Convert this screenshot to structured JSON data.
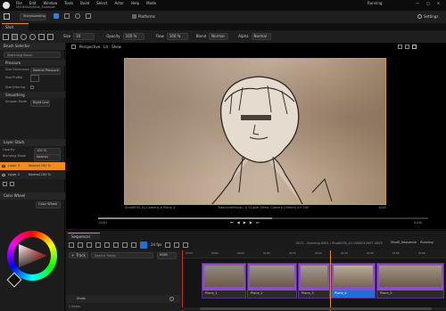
{
  "window": {
    "menu": [
      "File",
      "Edit",
      "Window",
      "Tools",
      "Build",
      "Select",
      "Actor",
      "Help",
      "Mode"
    ],
    "project": "MyUEStorytelle_Example",
    "mode_label": "Running",
    "level_tab": "Shot",
    "mode_dropdown": "Storyboarding",
    "platforms": "Platforms",
    "settings": "Settings"
  },
  "toolbar": {
    "size_label": "Size",
    "size_value": "10",
    "opacity_label": "Opacity",
    "opacity_value": "100 %",
    "flow_label": "Flow",
    "flow_value": "100 %",
    "blend_label": "Blend",
    "blend_value": "Normal",
    "alpha_label": "Alpha",
    "alpha_value": "Normal"
  },
  "brush_panel": {
    "title": "Brush Selector",
    "brush_name": "Sketching Brush",
    "section_pressure": "Pressure",
    "size_dimension_label": "Size Dimension",
    "size_dimension_value": "Normal Pressure",
    "size_profile_label": "Size Profile",
    "jitter_label": "Size Jittering",
    "section_smoothing": "Smoothing",
    "smooth_mode_label": "Smooth Mode",
    "smooth_mode_value": "Right Line"
  },
  "layer_stack": {
    "title": "Layer Stack",
    "opacity_label": "Opacity",
    "opacity_value": "100 %",
    "blending_label": "Blending Mode",
    "blending_value": "Normal",
    "layers": [
      {
        "name": "Layer 3",
        "mode": "Normal 100 %",
        "selected": true
      },
      {
        "name": "Layer 2",
        "mode": "Normal 100 %",
        "selected": false
      }
    ]
  },
  "color_wheel": {
    "title": "Color Wheel",
    "dropdown": "Color Wheel",
    "hue_color": "#e02020"
  },
  "viewport": {
    "perspective": "Perspective",
    "lit": "Lit",
    "show": "Show",
    "info_left": "Shot0030_01 Camera_b Plane_4",
    "info_center": "TakeLevelVisual / A S1/plat Filmx: Camera (50mm) A+ 100",
    "info_right": "1045",
    "frame_left": "-0001",
    "frame_right": "0100"
  },
  "sequencer": {
    "title": "Sequencer",
    "fps": "24 fps",
    "breadcrumb": "0071 - Running 0001 / Shot0030_01 0000012557 0003",
    "shot_label": "Shot0_Sequence",
    "running": "Running",
    "track_button": "Track",
    "search_placeholder": "Search Tracks",
    "frame_value": "0080",
    "row_label": "Shots",
    "items_count": "1 items",
    "ruler": [
      "0070",
      "0080",
      "0090",
      "0100",
      "0110",
      "0120",
      "0130",
      "0140",
      "0150",
      "0160"
    ],
    "sections": [
      {
        "name": "Plane_1",
        "selected": false
      },
      {
        "name": "Plane_2",
        "selected": false
      },
      {
        "name": "Plane_3",
        "selected": false
      },
      {
        "name": "Plane_4",
        "selected": true
      },
      {
        "name": "Plane_5",
        "selected": false
      }
    ]
  },
  "colors": {
    "accent_orange": "#f08c1c",
    "selection_blue": "#1f6fd6",
    "section_purple": "#8a4fc4"
  }
}
